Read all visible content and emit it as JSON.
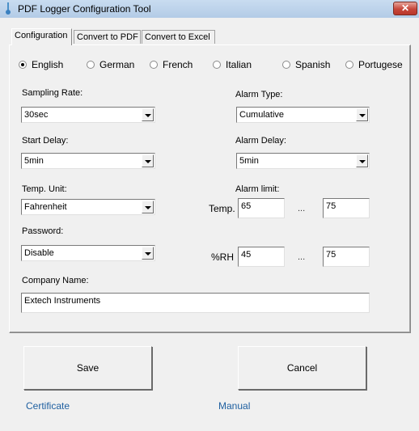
{
  "window": {
    "title": "PDF Logger Configuration Tool",
    "close_label": "✕",
    "icon": "thermometer-icon"
  },
  "tabs": [
    {
      "label": "Configuration",
      "active": true
    },
    {
      "label": "Convert to PDF",
      "active": false
    },
    {
      "label": "Convert to Excel",
      "active": false
    }
  ],
  "languages": [
    {
      "label": "English",
      "checked": true
    },
    {
      "label": "German",
      "checked": false
    },
    {
      "label": "French",
      "checked": false
    },
    {
      "label": "Italian",
      "checked": false
    },
    {
      "label": "Spanish",
      "checked": false
    },
    {
      "label": "Portugese",
      "checked": false
    }
  ],
  "fields": {
    "sampling_rate": {
      "label": "Sampling Rate:",
      "value": "30sec"
    },
    "start_delay": {
      "label": "Start Delay:",
      "value": "5min"
    },
    "temp_unit": {
      "label": "Temp. Unit:",
      "value": "Fahrenheit"
    },
    "password": {
      "label": "Password:",
      "value": "Disable"
    },
    "alarm_type": {
      "label": "Alarm Type:",
      "value": "Cumulative"
    },
    "alarm_delay": {
      "label": "Alarm Delay:",
      "value": "5min"
    },
    "company_name": {
      "label": "Company Name:",
      "value": "Extech Instruments"
    }
  },
  "alarm_limit": {
    "label": "Alarm limit:",
    "separator": "...",
    "temp": {
      "label": "Temp.",
      "low": "65",
      "high": "75"
    },
    "rh": {
      "label": "%RH",
      "low": "45",
      "high": "75"
    }
  },
  "buttons": {
    "save": "Save",
    "cancel": "Cancel"
  },
  "links": {
    "certificate": "Certificate",
    "manual": "Manual"
  }
}
